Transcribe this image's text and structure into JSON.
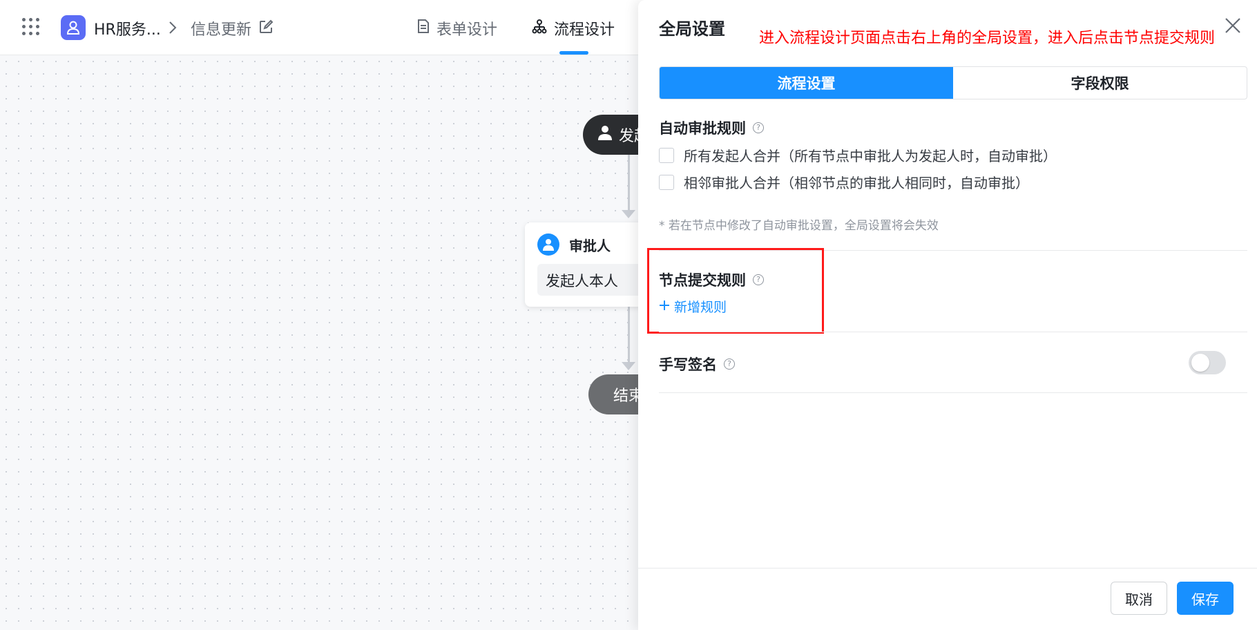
{
  "header": {
    "app_name": "HR服务...",
    "form_name": "信息更新",
    "tabs": [
      {
        "label": "表单设计",
        "active": false
      },
      {
        "label": "流程设计",
        "active": true
      }
    ],
    "icons": [
      "apps-grid-icon",
      "app-person-icon",
      "chevron-right-icon",
      "edit-icon",
      "document-icon",
      "flow-icon"
    ]
  },
  "canvas": {
    "start_node_label": "发起",
    "approver_title": "审批人",
    "approver_value": "发起人本人",
    "end_node_label": "结束"
  },
  "drawer": {
    "title": "全局设置",
    "annotation": "进入流程设计页面点击右上角的全局设置，进入后点击节点提交规则",
    "segments": [
      {
        "label": "流程设置",
        "active": true
      },
      {
        "label": "字段权限",
        "active": false
      }
    ],
    "auto_approval": {
      "title": "自动审批规则",
      "options": [
        {
          "label": "所有发起人合并（所有节点中审批人为发起人时，自动审批）",
          "checked": false
        },
        {
          "label": "相邻审批人合并（相邻节点的审批人相同时，自动审批）",
          "checked": false
        }
      ],
      "note": "* 若在节点中修改了自动审批设置，全局设置将会失效"
    },
    "node_submit_rules": {
      "title": "节点提交规则",
      "add_label": "新增规则"
    },
    "handwritten_signature": {
      "title": "手写签名",
      "enabled": false
    },
    "help_glyph": "?",
    "footer": {
      "cancel_label": "取消",
      "save_label": "保存"
    }
  },
  "colors": {
    "primary": "#1890ff",
    "annotation_red": "#ff0000",
    "start_node": "#2b2d30",
    "end_node": "#6b6d70",
    "app_icon": "#5b6cf5"
  }
}
